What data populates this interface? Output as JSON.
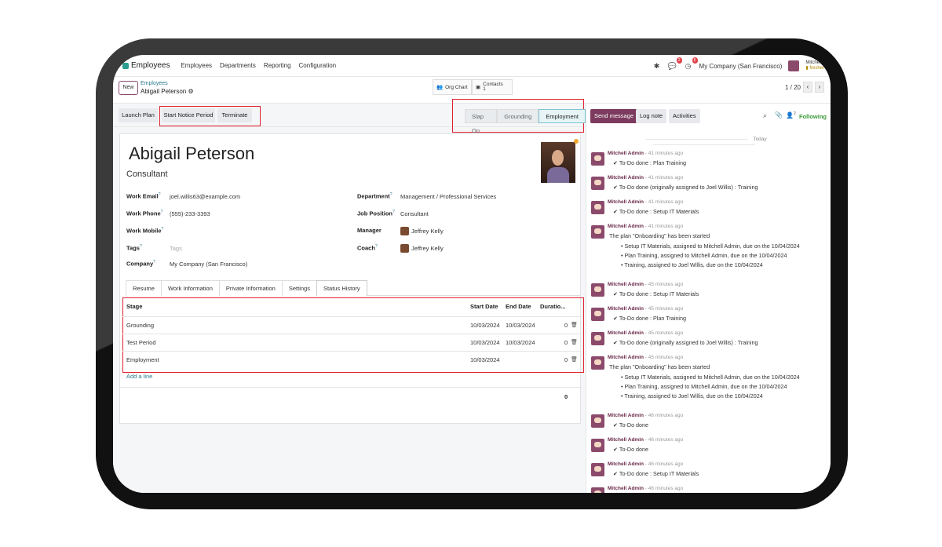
{
  "topnav": {
    "app_name": "Employees",
    "menu": [
      "Employees",
      "Departments",
      "Reporting",
      "Configuration"
    ],
    "messages_count": "2",
    "activities_count": "6",
    "company": "My Company (San Francisco)",
    "user_name": "Mitchell",
    "user_db": "fresher"
  },
  "control_panel": {
    "new_label": "New",
    "breadcrumb_parent": "Employees",
    "breadcrumb_current": "Abigail Peterson",
    "org_chart_label": "Org Chart",
    "contacts_label": "Contacts",
    "contacts_count": "1",
    "pager": "1 / 20"
  },
  "actions": {
    "launch_plan": "Launch Plan",
    "start_notice": "Start Notice Period",
    "terminate": "Terminate"
  },
  "stages": [
    "Slap On",
    "Grounding",
    "Employment"
  ],
  "active_stage": "Employment",
  "employee": {
    "name": "Abigail Peterson",
    "job_title": "Consultant",
    "work_email_label": "Work Email",
    "work_email": "joel.willis63@example.com",
    "work_phone_label": "Work Phone",
    "work_phone": "(555)-233-3393",
    "work_mobile_label": "Work Mobile",
    "tags_label": "Tags",
    "tags_placeholder": "Tags",
    "company_label": "Company",
    "company": "My Company (San Francisco)",
    "department_label": "Department",
    "department": "Management / Professional Services",
    "job_position_label": "Job Position",
    "job_position": "Consultant",
    "manager_label": "Manager",
    "manager": "Jeffrey Kelly",
    "coach_label": "Coach",
    "coach": "Jeffrey Kelly"
  },
  "tabs": [
    "Resume",
    "Work Information",
    "Private Information",
    "Settings",
    "Status History"
  ],
  "status_history": {
    "headers": {
      "stage": "Stage",
      "start": "Start Date",
      "end": "End Date",
      "duration": "Duratio..."
    },
    "rows": [
      {
        "stage": "Grounding",
        "start": "10/03/2024",
        "end": "10/03/2024",
        "duration": "0"
      },
      {
        "stage": "Test Period",
        "start": "10/03/2024",
        "end": "10/03/2024",
        "duration": "0"
      },
      {
        "stage": "Employment",
        "start": "10/03/2024",
        "end": "",
        "duration": "0"
      }
    ],
    "add_line": "Add a line",
    "total": "0"
  },
  "chatter": {
    "send_message": "Send message",
    "log_note": "Log note",
    "activities": "Activities",
    "followers_count": "2",
    "following": "Following",
    "today": "Today",
    "messages": [
      {
        "author": "Mitchell Admin",
        "time": "- 41 minutes ago",
        "body": "✔ To-Do done : Plan Training"
      },
      {
        "author": "Mitchell Admin",
        "time": "- 41 minutes ago",
        "body": "✔ To-Do done (originally assigned to Joel Willis) : Training"
      },
      {
        "author": "Mitchell Admin",
        "time": "- 41 minutes ago",
        "body": "✔ To-Do done : Setup IT Materials"
      },
      {
        "author": "Mitchell Admin",
        "time": "- 41 minutes ago",
        "body": "The plan \"Onboarding\" has been started",
        "list": [
          "Setup IT Materials, assigned to Mitchell Admin, due on the 10/04/2024",
          "Plan Training, assigned to Mitchell Admin, due on the 10/04/2024",
          "Training, assigned to Joel Willis, due on the 10/04/2024"
        ]
      },
      {
        "author": "Mitchell Admin",
        "time": "- 45 minutes ago",
        "body": "✔ To-Do done : Setup IT Materials"
      },
      {
        "author": "Mitchell Admin",
        "time": "- 45 minutes ago",
        "body": "✔ To-Do done : Plan Training"
      },
      {
        "author": "Mitchell Admin",
        "time": "- 45 minutes ago",
        "body": "✔ To-Do done (originally assigned to Joel Willis) : Training"
      },
      {
        "author": "Mitchell Admin",
        "time": "- 45 minutes ago",
        "body": "The plan \"Onboarding\" has been started",
        "list": [
          "Setup IT Materials, assigned to Mitchell Admin, due on the 10/04/2024",
          "Plan Training, assigned to Mitchell Admin, due on the 10/04/2024",
          "Training, assigned to Joel Willis, due on the 10/04/2024"
        ]
      },
      {
        "author": "Mitchell Admin",
        "time": "- 46 minutes ago",
        "body": "✔ To-Do done"
      },
      {
        "author": "Mitchell Admin",
        "time": "- 46 minutes ago",
        "body": "✔ To-Do done"
      },
      {
        "author": "Mitchell Admin",
        "time": "- 46 minutes ago",
        "body": "✔ To-Do done : Setup IT Materials"
      },
      {
        "author": "Mitchell Admin",
        "time": "- 46 minutes ago",
        "body": ""
      }
    ]
  }
}
